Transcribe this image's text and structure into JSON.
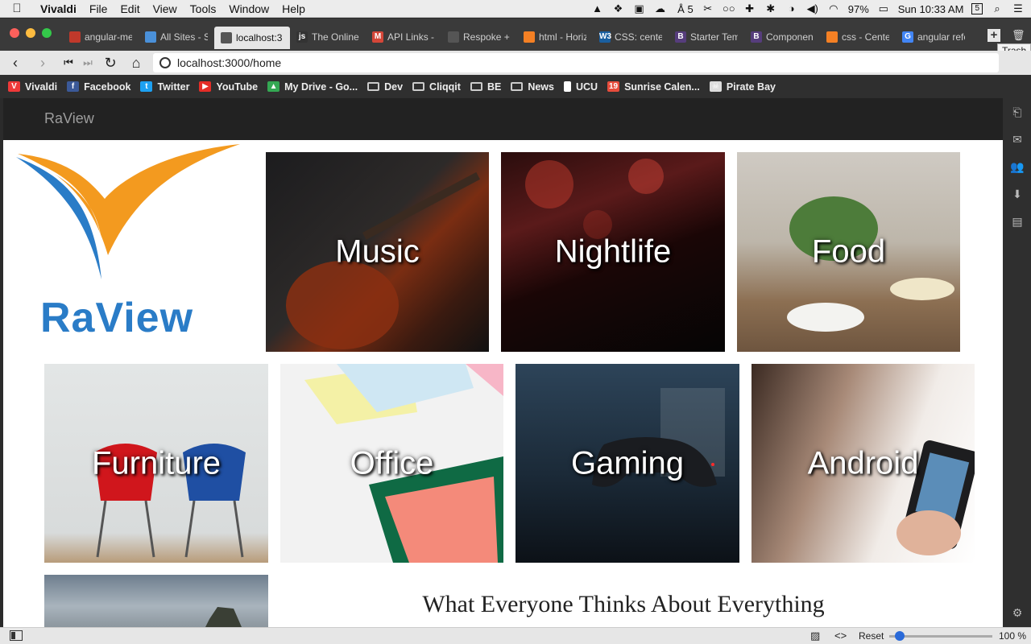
{
  "menubar": {
    "app": "Vivaldi",
    "items": [
      "File",
      "Edit",
      "View",
      "Tools",
      "Window",
      "Help"
    ],
    "status": {
      "badge_count": "5",
      "battery": "97%",
      "clock": "Sun 10:33 AM",
      "calendar_day": "5"
    }
  },
  "tabs": [
    {
      "label": "angular-me",
      "color": "#c0392b",
      "icon": "shield-icon"
    },
    {
      "label": "All Sites - S",
      "color": "#4a90d9",
      "icon": "stack-icon"
    },
    {
      "label": "localhost:3",
      "color": "#555555",
      "icon": "globe-icon"
    },
    {
      "label": "The Online",
      "color": "#333333",
      "icon": "jsl-icon"
    },
    {
      "label": "API Links -",
      "color": "#d44638",
      "icon": "gmail-icon"
    },
    {
      "label": "Respoke +",
      "color": "#555555",
      "icon": "globe-icon"
    },
    {
      "label": "html - Horiz",
      "color": "#f48024",
      "icon": "stackoverflow-icon"
    },
    {
      "label": "CSS: cente",
      "color": "#1a5fa0",
      "icon": "w3-icon"
    },
    {
      "label": "Starter Tem",
      "color": "#563d7c",
      "icon": "bootstrap-icon"
    },
    {
      "label": "Componen",
      "color": "#563d7c",
      "icon": "bootstrap-icon"
    },
    {
      "label": "css - Cente",
      "color": "#f48024",
      "icon": "stackoverflow-icon"
    },
    {
      "label": "angular refe",
      "color": "#4285f4",
      "icon": "google-icon"
    }
  ],
  "tab_glyphs": [
    "",
    "",
    "",
    "js",
    "M",
    "",
    "",
    "W3",
    "B",
    "B",
    "",
    "G"
  ],
  "trash_tooltip": "Trash",
  "address": {
    "url": "localhost:3000/home"
  },
  "bookmarks": [
    {
      "label": "Vivaldi",
      "color": "#ef3939",
      "icon": "vivaldi-icon"
    },
    {
      "label": "Facebook",
      "color": "#3b5998",
      "icon": "facebook-icon"
    },
    {
      "label": "Twitter",
      "color": "#1da1f2",
      "icon": "twitter-icon"
    },
    {
      "label": "YouTube",
      "color": "#e52d27",
      "icon": "youtube-icon"
    },
    {
      "label": "My Drive - Go...",
      "color": "#34a853",
      "icon": "drive-icon"
    },
    {
      "label": "Dev",
      "color": "#cccccc",
      "icon": "folder-icon"
    },
    {
      "label": "Cliqqit",
      "color": "#cccccc",
      "icon": "folder-icon"
    },
    {
      "label": "BE",
      "color": "#cccccc",
      "icon": "folder-icon"
    },
    {
      "label": "News",
      "color": "#cccccc",
      "icon": "folder-icon"
    },
    {
      "label": "UCU",
      "color": "#ffffff",
      "icon": "page-icon"
    },
    {
      "label": "Sunrise Calen...",
      "color": "#e74c3c",
      "icon": "sunrise-icon"
    },
    {
      "label": "Pirate Bay",
      "color": "#dddddd",
      "icon": "pirate-icon"
    }
  ],
  "bookmark_glyphs": [
    "V",
    "f",
    "t",
    "▶",
    "▲",
    "",
    "",
    "",
    "",
    "",
    "19",
    "☠"
  ],
  "site": {
    "brand": "RaView",
    "logo_text": "RaView",
    "tagline": "What Everyone Thinks About Everything",
    "categories": [
      "Music",
      "Nightlife",
      "Food",
      "Furniture",
      "Office",
      "Gaming",
      "Android"
    ]
  },
  "statusbar": {
    "reset": "Reset",
    "zoom": "100 %",
    "zoom_fraction": 0.1
  }
}
